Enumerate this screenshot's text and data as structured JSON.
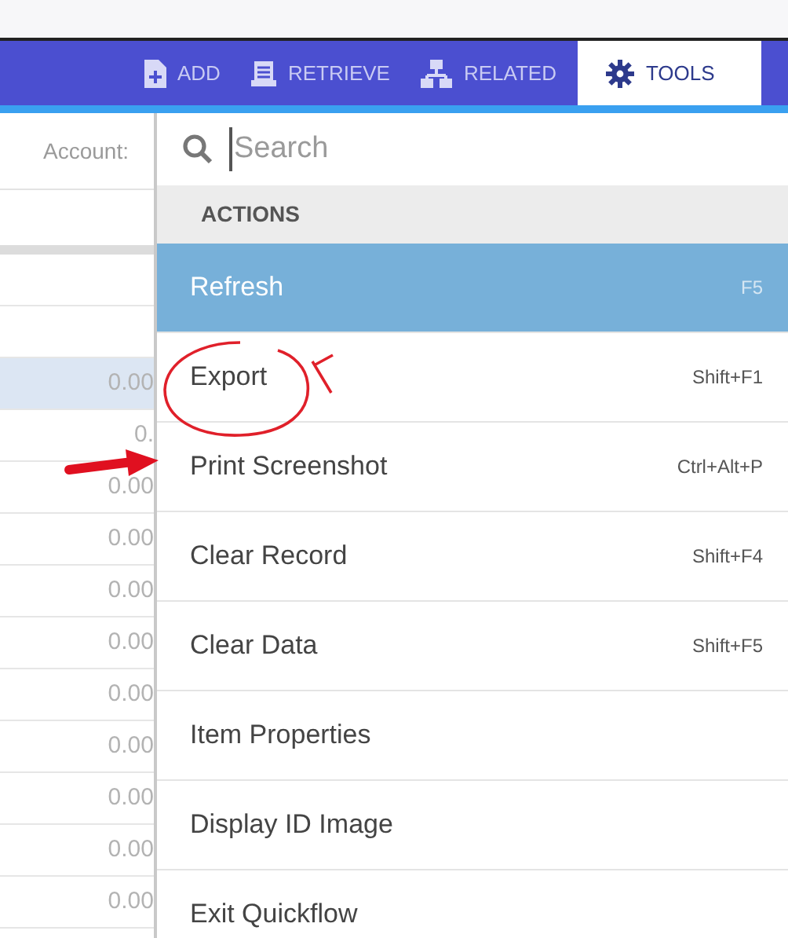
{
  "toolbar": {
    "tabs": [
      {
        "label": "ADD",
        "selected": false
      },
      {
        "label": "RETRIEVE",
        "selected": false
      },
      {
        "label": "RELATED",
        "selected": false
      },
      {
        "label": "TOOLS",
        "selected": true
      }
    ]
  },
  "record": {
    "account_label": "Account:",
    "values": [
      {
        "text": "0.00",
        "selected": true
      },
      {
        "text": "0.",
        "selected": false
      },
      {
        "text": "0.00",
        "selected": false
      },
      {
        "text": "0.00",
        "selected": false
      },
      {
        "text": "0.00",
        "selected": false
      },
      {
        "text": "0.00",
        "selected": false
      },
      {
        "text": "0.00",
        "selected": false
      },
      {
        "text": "0.00",
        "selected": false
      },
      {
        "text": "0.00",
        "selected": false
      },
      {
        "text": "0.00",
        "selected": false
      },
      {
        "text": "0.00",
        "selected": false
      }
    ]
  },
  "menu": {
    "search": {
      "placeholder": "Search"
    },
    "section": "ACTIONS",
    "items": [
      {
        "label": "Refresh",
        "shortcut": "F5",
        "selected": true
      },
      {
        "label": "Export",
        "shortcut": "Shift+F1",
        "selected": false
      },
      {
        "label": "Print Screenshot",
        "shortcut": "Ctrl+Alt+P",
        "selected": false
      },
      {
        "label": "Clear Record",
        "shortcut": "Shift+F4",
        "selected": false
      },
      {
        "label": "Clear Data",
        "shortcut": "Shift+F5",
        "selected": false
      },
      {
        "label": "Item Properties",
        "selected": false
      },
      {
        "label": "Display ID Image",
        "selected": false
      },
      {
        "label": "Exit Quickflow",
        "selected": false
      }
    ]
  }
}
